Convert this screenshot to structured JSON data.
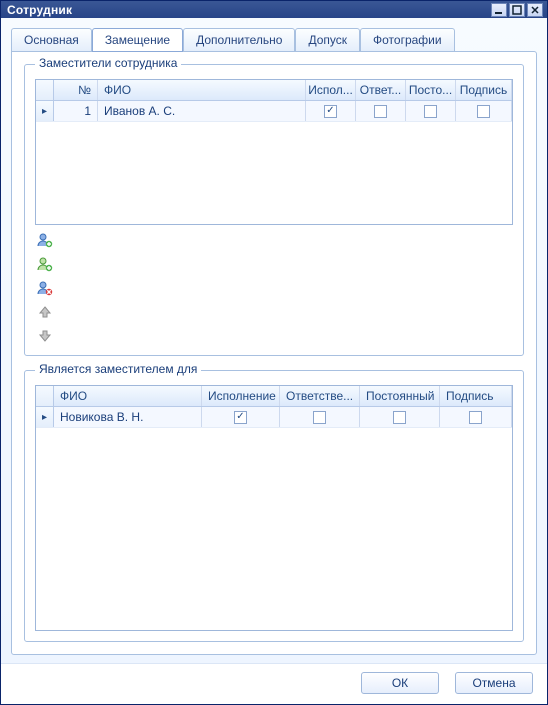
{
  "window": {
    "title": "Сотрудник"
  },
  "tabs": {
    "main": "Основная",
    "sub": "Замещение",
    "extra": "Дополнительно",
    "access": "Допуск",
    "photos": "Фотографии"
  },
  "group1": {
    "title": "Заместители сотрудника",
    "columns": {
      "num": "№",
      "fio": "ФИО",
      "isp": "Испол...",
      "otv": "Ответ...",
      "post": "Посто...",
      "pod": "Подпись"
    },
    "rows": [
      {
        "num": "1",
        "fio": "Иванов А. С.",
        "isp": true,
        "otv": false,
        "post": false,
        "pod": false
      }
    ]
  },
  "group2": {
    "title": "Является заместителем для",
    "columns": {
      "fio": "ФИО",
      "isp": "Исполнение",
      "otv": "Ответстве...",
      "post": "Постоянный",
      "pod": "Подпись"
    },
    "rows": [
      {
        "fio": "Новикова В. Н.",
        "isp": true,
        "otv": false,
        "post": false,
        "pod": false
      }
    ]
  },
  "buttons": {
    "ok": "ОК",
    "cancel": "Отмена"
  }
}
